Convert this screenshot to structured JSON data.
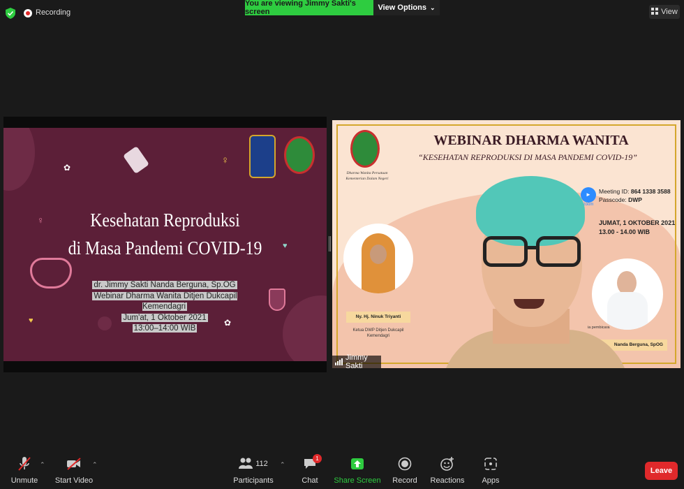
{
  "topbar": {
    "recording_label": "Recording",
    "viewing_banner": "You are viewing Jimmy Sakti's screen",
    "view_options_label": "View Options",
    "view_label": "View"
  },
  "slide": {
    "title_line1": "Kesehatan Reproduksi",
    "title_line2": "di Masa Pandemi COVID-19",
    "presenter": "dr. Jimmy Sakti Nanda Berguna, Sp.OG",
    "event": "Webinar Dharma Wanita Ditjen Dukcapil Kemendagri",
    "date": "Jum'at, 1 Oktober 2021",
    "time": "13:00–14:00 WIB"
  },
  "webcam": {
    "participant_name": "Jimmy Sakti",
    "poster": {
      "title": "WEBINAR DHARMA WANITA",
      "subtitle": "“KESEHATAN REPRODUKSI DI MASA PANDEMI COVID-19”",
      "org_line1": "Dharma Wanita Persatuan",
      "org_line2": "Kementerian Dalam Negeri",
      "meeting_id_label": "Meeting ID:",
      "meeting_id": "864 1338 3588",
      "passcode_label": "Passcode:",
      "passcode": "DWP",
      "zoom_label": "zoom",
      "date": "JUMAT, 1 OKTOBER 2021",
      "time": "13.00 - 14.00 WIB",
      "speaker1_name": "Ny. Hj. Ninuk Triyanti",
      "speaker1_role1": "Ketua DWP Ditjen Dukcapil",
      "speaker1_role2": "Kemendagri",
      "speaker2_tag": "ia pembicara",
      "speaker2_name": "Nanda Berguna, SpOG"
    }
  },
  "toolbar": {
    "unmute": "Unmute",
    "start_video": "Start Video",
    "participants": "Participants",
    "participants_count": "112",
    "chat": "Chat",
    "chat_badge": "1",
    "share_screen": "Share Screen",
    "record": "Record",
    "reactions": "Reactions",
    "apps": "Apps",
    "leave": "Leave"
  },
  "colors": {
    "banner_green": "#2ecc40",
    "leave_red": "#e0292b",
    "slide_bg": "#5c1f38",
    "share_green": "#2ecc40"
  }
}
